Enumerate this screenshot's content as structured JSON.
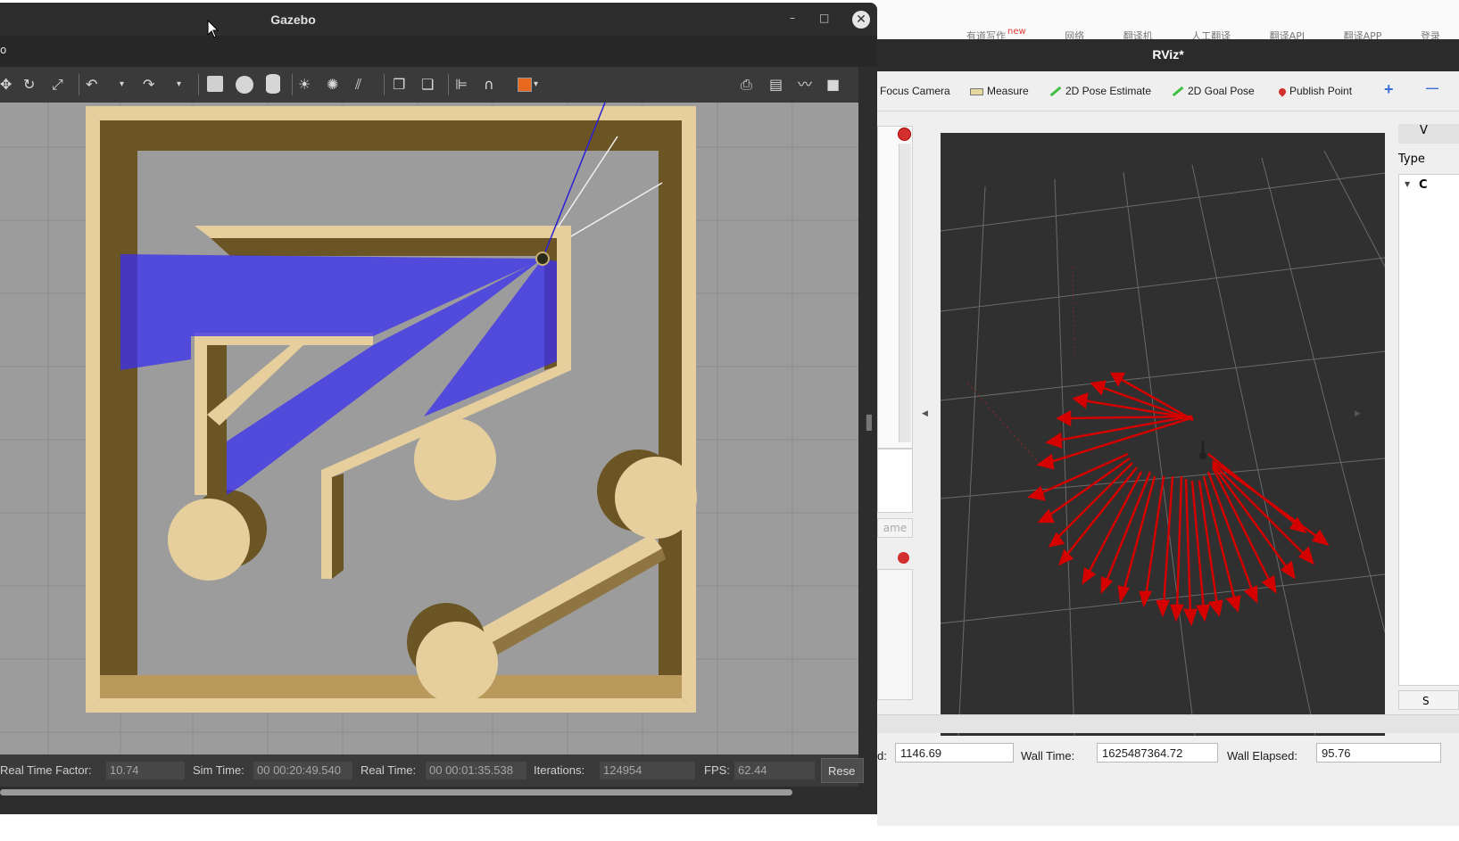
{
  "browser_bg": {
    "nav_items": [
      "有道写作",
      "网络",
      "翻译机",
      "人工翻译",
      "翻译API",
      "翻译APP",
      "登录"
    ],
    "new_badge": "new"
  },
  "gazebo": {
    "title": "Gazebo",
    "menu_first": "o",
    "window_controls": {
      "minimize": "–",
      "maximize": "□",
      "close": "✕"
    },
    "status": {
      "real_time_factor_label": "Real Time Factor:",
      "real_time_factor_value": "10.74",
      "sim_time_label": "Sim Time:",
      "sim_time_value": "00 00:20:49.540",
      "real_time_label": "Real Time:",
      "real_time_value": "00 00:01:35.538",
      "iterations_label": "Iterations:",
      "iterations_value": "124954",
      "fps_label": "FPS:",
      "fps_value": "62.44",
      "reset_label": "Rese"
    }
  },
  "rviz": {
    "title": "RViz*",
    "toolbar": {
      "focus_camera": "Focus Camera",
      "measure": "Measure",
      "pose_estimate": "2D Pose Estimate",
      "goal_pose": "2D Goal Pose",
      "publish_point": "Publish Point",
      "plus": "+",
      "minus": "—"
    },
    "left_button_fragment": "ame",
    "right_panel": {
      "header_fragment": "V",
      "type_label": "Type",
      "tree_item_fragment": "C",
      "button_fragment": "S"
    },
    "status": {
      "ros_elapsed_label_fragment": "d:",
      "ros_elapsed_value": "1146.69",
      "wall_time_label": "Wall Time:",
      "wall_time_value": "1625487364.72",
      "wall_elapsed_label": "Wall Elapsed:",
      "wall_elapsed_value": "95.76"
    }
  }
}
